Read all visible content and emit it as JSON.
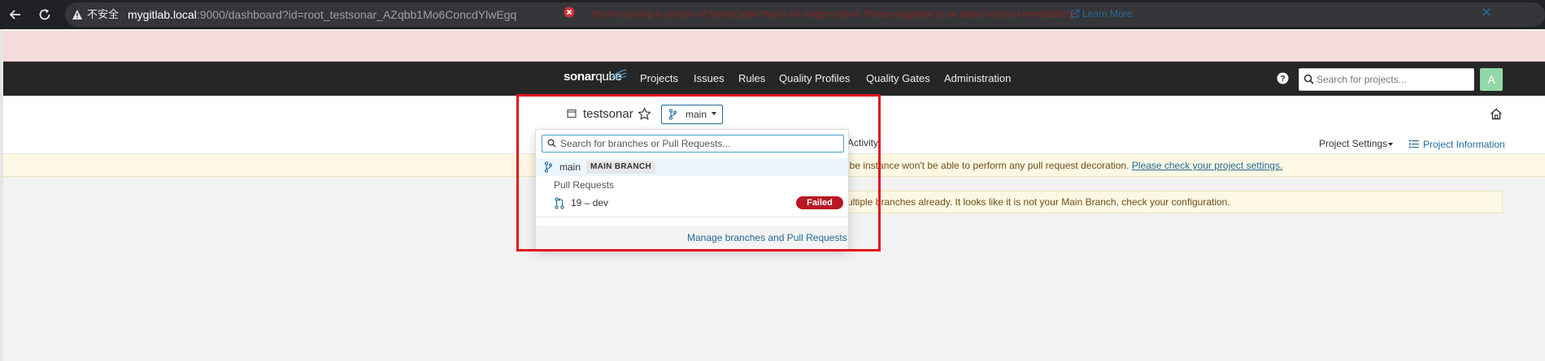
{
  "browser": {
    "insecure_label": "不安全",
    "url_host": "mygitlab.local",
    "url_path": ":9000/dashboard?id=root_testsonar_AZqbb1Mo6ConcdYlwEgq"
  },
  "alert": {
    "message": "You're running a version of SonarQube that is no longer active. Please upgrade to an active version immediately.",
    "link": "Learn More"
  },
  "topnav": {
    "logo_bold": "sonar",
    "logo_thin": "qube",
    "items": [
      "Projects",
      "Issues",
      "Rules",
      "Quality Profiles",
      "Quality Gates",
      "Administration"
    ],
    "search_placeholder": "Search for projects...",
    "avatar": "A"
  },
  "project": {
    "name": "testsonar",
    "branch": "main",
    "activity_tab": "Activity",
    "settings": "Project Settings",
    "info": "Project Information"
  },
  "warning": {
    "text": "ube instance won't be able to perform any pull request decoration.",
    "link": "Please check your project settings."
  },
  "notice": {
    "text": "ultiple branches already. It looks like it is not your Main Branch, check your configuration."
  },
  "dropdown": {
    "search_placeholder": "Search for branches or Pull Requests...",
    "main_label": "main",
    "main_badge": "MAIN BRANCH",
    "section_title": "Pull Requests",
    "pr_label": "19 – dev",
    "pr_status": "Failed",
    "footer_link": "Manage branches and Pull Requests"
  },
  "colors": {
    "accent": "#236a97",
    "failed": "#b81723",
    "alert_bg": "#f4dcdc",
    "nav_bg": "#262626",
    "highlight": "#e0141e"
  },
  "icons": [
    "back-arrow-icon",
    "reload-icon",
    "warning-triangle-icon",
    "error-circle-icon",
    "external-link-icon",
    "close-icon",
    "sonarqube-logo-icon",
    "help-icon",
    "search-icon",
    "project-icon",
    "star-icon",
    "branch-icon",
    "home-icon",
    "list-icon",
    "pull-request-icon"
  ]
}
